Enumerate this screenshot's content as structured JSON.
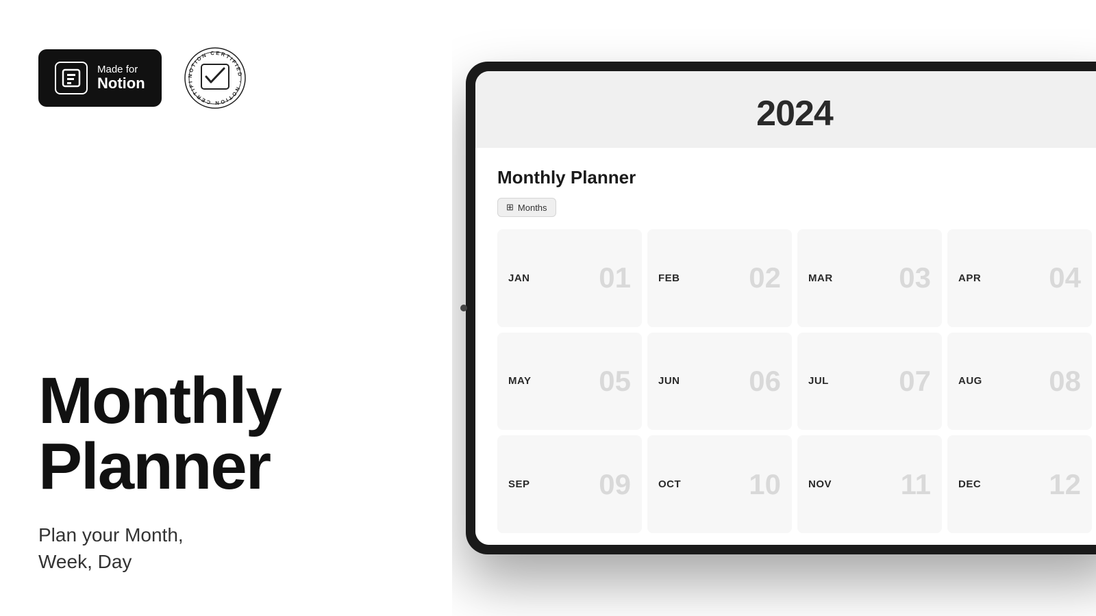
{
  "badges": {
    "made_for_notion": {
      "made_for": "Made for",
      "notion": "Notion",
      "icon_label": "N"
    },
    "certified": {
      "alt": "Notion Certified"
    }
  },
  "left": {
    "heading_line1": "Monthly",
    "heading_line2": "Planner",
    "subtitle": "Plan your Month,\nWeek, Day"
  },
  "tablet": {
    "year": "2024",
    "planner_title": "Monthly Planner",
    "months_tab_label": "Months",
    "months": [
      {
        "name": "JAN",
        "num": "01"
      },
      {
        "name": "FEB",
        "num": "02"
      },
      {
        "name": "MAR",
        "num": "03"
      },
      {
        "name": "APR",
        "num": "04"
      },
      {
        "name": "MAY",
        "num": "05"
      },
      {
        "name": "JUN",
        "num": "06"
      },
      {
        "name": "JUL",
        "num": "07"
      },
      {
        "name": "AUG",
        "num": "08"
      },
      {
        "name": "SEP",
        "num": "09"
      },
      {
        "name": "OCT",
        "num": "10"
      },
      {
        "name": "NOV",
        "num": "11"
      },
      {
        "name": "DEC",
        "num": "12"
      }
    ]
  }
}
